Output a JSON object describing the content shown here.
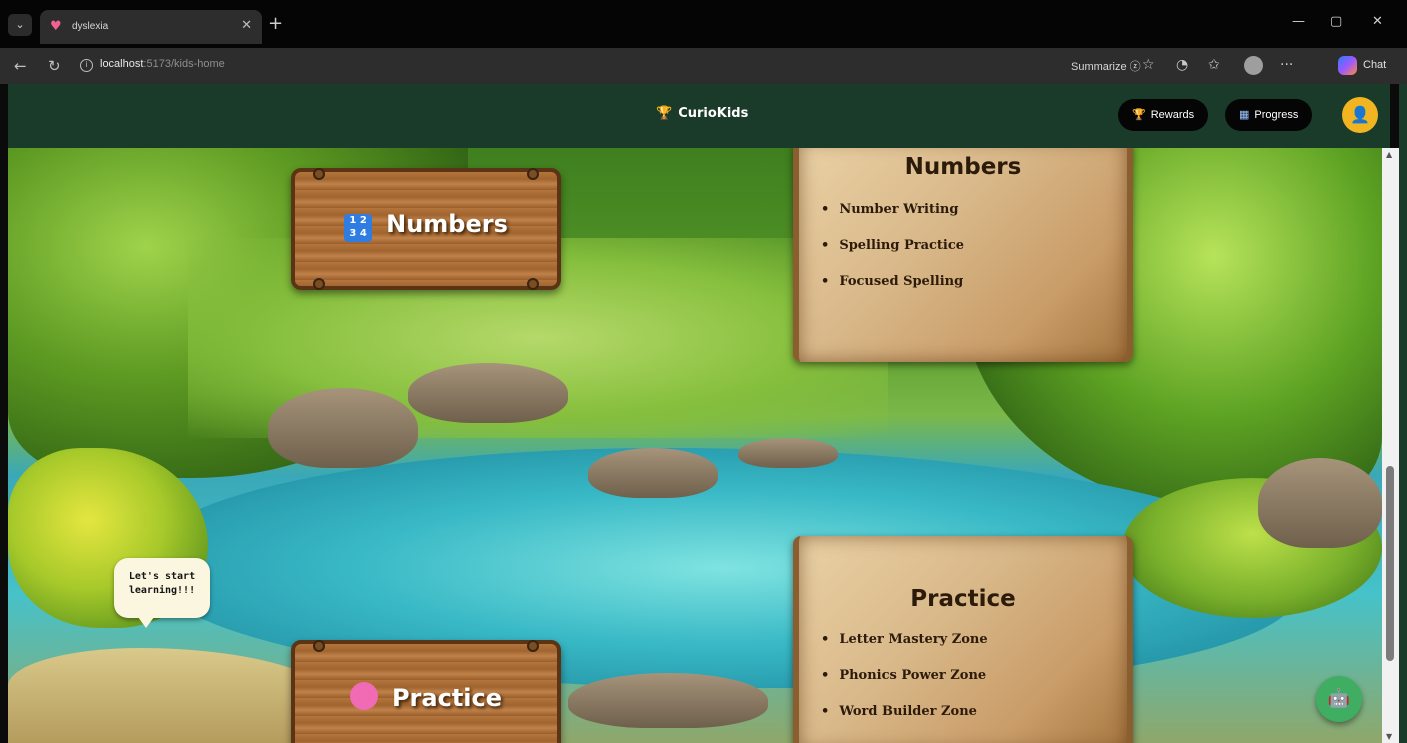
{
  "browser": {
    "tab_title": "dyslexia",
    "tab_close": "✕",
    "new_tab": "+",
    "url_host": "localhost",
    "url_path": ":5173/kids-home",
    "summarize_label": "Summarize",
    "chat_label": "Chat",
    "window_controls": [
      "—",
      "▢",
      "✕"
    ]
  },
  "header": {
    "brand": "CurioKids",
    "rewards_label": "Rewards",
    "progress_label": "Progress"
  },
  "scene": {
    "numbers_sign": "Numbers",
    "practice_sign": "Practice",
    "numbers_panel": {
      "title": "Numbers",
      "items": [
        "Number Writing",
        "Spelling Practice",
        "Focused Spelling"
      ]
    },
    "practice_panel": {
      "title": "Practice",
      "items": [
        "Letter Mastery Zone",
        "Phonics Power Zone",
        "Word Builder Zone"
      ]
    },
    "speech": [
      "Let's start",
      "learning!!!"
    ]
  },
  "icons": {
    "trophy": "trophy-icon",
    "chart": "chart-icon",
    "user": "user-icon",
    "numbers": "number-blocks-icon",
    "brain": "brain-icon",
    "chatbot": "chatbot-icon"
  },
  "colors": {
    "header_bg": "#1b3b2a",
    "avatar": "#f2b522",
    "fab": "#3fae62"
  }
}
